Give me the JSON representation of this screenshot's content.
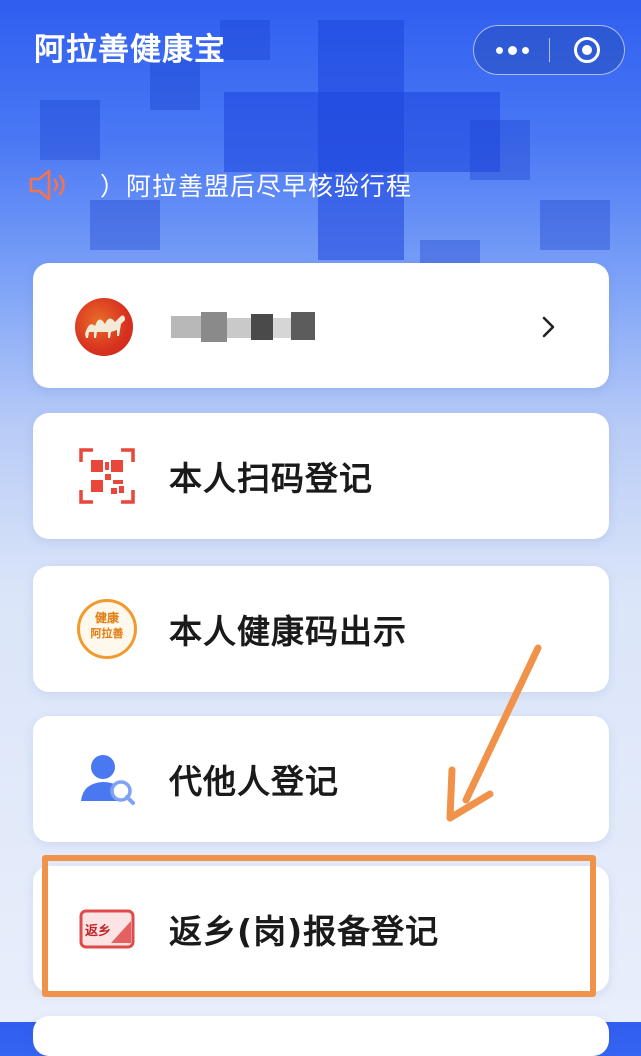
{
  "header": {
    "title": "阿拉善健康宝"
  },
  "notice": {
    "text": "）阿拉善盟后尽早核验行程"
  },
  "user": {
    "name_obscured": true
  },
  "menu": [
    {
      "label": "本人扫码登记",
      "icon": "qr-code-icon"
    },
    {
      "label": "本人健康码出示",
      "icon": "health-code-badge-icon"
    },
    {
      "label": "代他人登记",
      "icon": "user-search-icon"
    },
    {
      "label": "返乡(岗)报备登记",
      "icon": "return-home-icon"
    }
  ],
  "badge": {
    "line1": "健康",
    "line2": "阿拉善"
  },
  "return_icon_text": "返乡",
  "colors": {
    "accent_blue": "#2f5ef0",
    "highlight_orange": "#f0924a",
    "qr_red": "#e8473a",
    "badge_orange": "#f29a2e",
    "user_icon_blue": "#4a78f0"
  }
}
